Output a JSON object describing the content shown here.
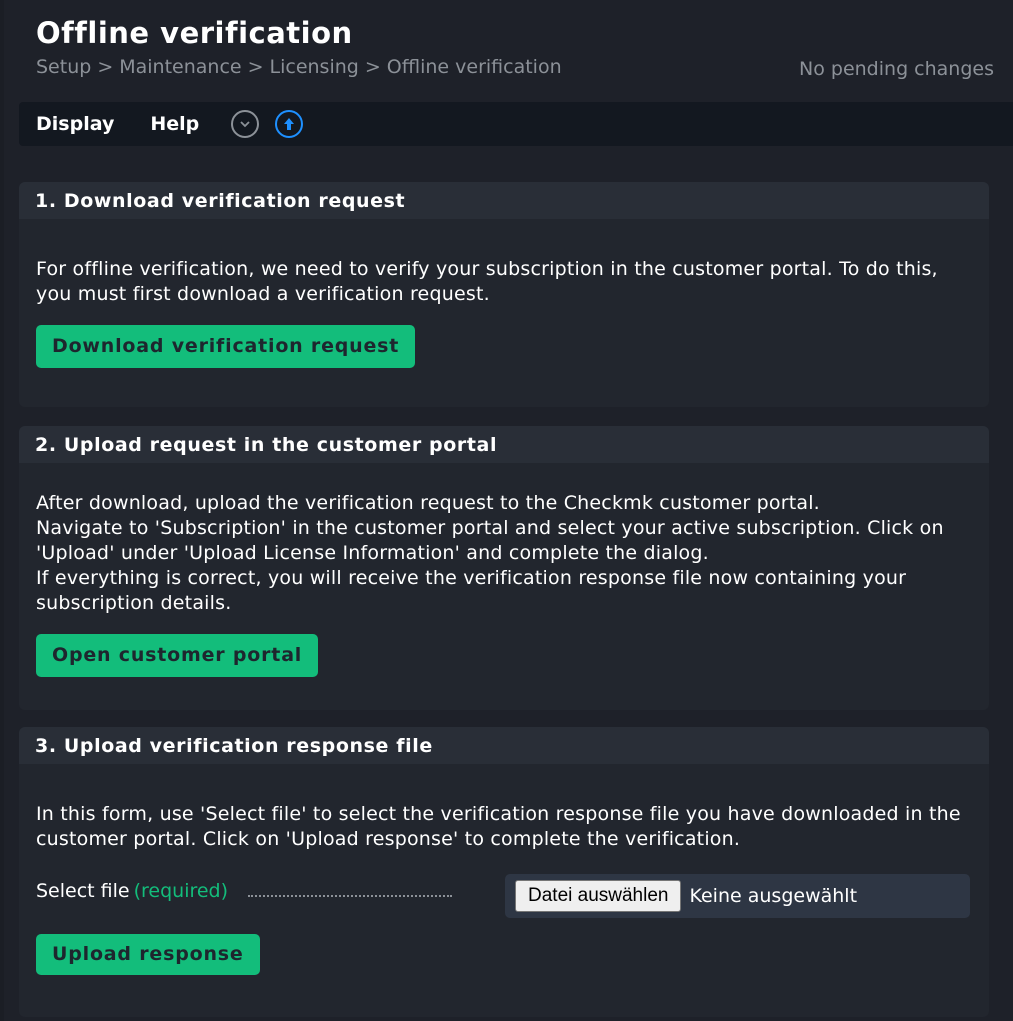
{
  "header": {
    "title": "Offline verification",
    "breadcrumb": [
      "Setup",
      "Maintenance",
      "Licensing",
      "Offline verification"
    ],
    "breadcrumb_separator": ">",
    "pending_changes": "No pending changes"
  },
  "menubar": {
    "items": [
      {
        "label": "Display",
        "icon": null
      },
      {
        "label": "Help",
        "icon": null
      }
    ],
    "icons": [
      {
        "name": "chevron-down-icon",
        "color": "#8c9198"
      },
      {
        "name": "upload-arrow-icon",
        "color": "#1e90ff"
      }
    ]
  },
  "sections": [
    {
      "title": "1. Download verification request",
      "paragraphs": [
        "For offline verification, we need to verify your subscription in the customer portal. To do this, you must first download a verification request."
      ],
      "button": "Download verification request"
    },
    {
      "title": "2. Upload request in the customer portal",
      "paragraphs": [
        "After download, upload the verification request to the Checkmk customer portal.",
        "Navigate to 'Subscription' in the customer portal and select your active subscription. Click on 'Upload' under 'Upload License Information' and complete the dialog.",
        "If everything is correct, you will receive the verification response file now containing your subscription details."
      ],
      "button": "Open customer portal"
    },
    {
      "title": "3. Upload verification response file",
      "paragraphs": [
        "In this form, use 'Select file' to select the verification response file you have downloaded in the customer portal. Click on 'Upload response' to complete the verification."
      ],
      "form": {
        "label": "Select file",
        "required": "(required)",
        "file_button": "Datei auswählen",
        "file_status": "Keine ausgewählt"
      },
      "button": "Upload response"
    }
  ],
  "colors": {
    "accent_green": "#13bd7b",
    "accent_blue": "#1e90ff",
    "background": "#1e2129",
    "panel": "#22262e",
    "panel_header": "#292e37"
  }
}
